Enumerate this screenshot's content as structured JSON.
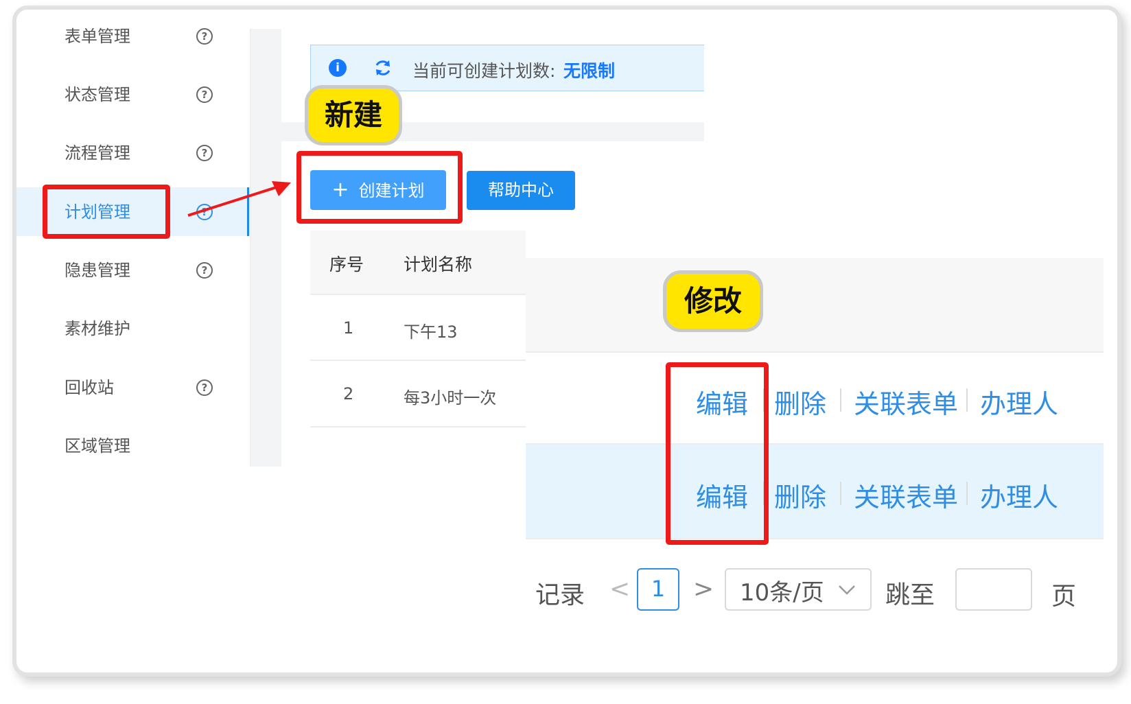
{
  "sidebar": {
    "items": [
      {
        "label": "表单管理",
        "help": "?"
      },
      {
        "label": "状态管理",
        "help": "?"
      },
      {
        "label": "流程管理",
        "help": "?"
      },
      {
        "label": "计划管理",
        "help": "?"
      },
      {
        "label": "隐患管理",
        "help": "?"
      },
      {
        "label": "素材维护"
      },
      {
        "label": "回收站",
        "help": "?"
      },
      {
        "label": "区域管理"
      }
    ],
    "active_index": 3
  },
  "notice": {
    "icon": "info-icon",
    "refresh_icon": "refresh-icon",
    "text": "当前可创建计划数:",
    "value": "无限制"
  },
  "toolbar": {
    "create_icon": "+",
    "create_label": "创建计划",
    "help_label": "帮助中心"
  },
  "callouts": {
    "new": "新建",
    "edit": "修改"
  },
  "table": {
    "headers": [
      "序号",
      "计划名称"
    ],
    "rows": [
      {
        "index": "1",
        "name": "下午13",
        "actions": [
          "编辑",
          "删除",
          "关联表单",
          "办理人"
        ]
      },
      {
        "index": "2",
        "name": "每3小时一次",
        "actions": [
          "编辑",
          "删除",
          "关联表单",
          "办理人"
        ]
      }
    ]
  },
  "pagination": {
    "records_text": "记录",
    "prev": "<",
    "current_page": "1",
    "next": ">",
    "page_size": "10条/页",
    "jump_label": "跳至",
    "page_suffix": "页"
  },
  "colors": {
    "primary": "#409eff",
    "link": "#2f8de4",
    "highlight": "#ee1a1a",
    "callout": "#ffe500"
  }
}
